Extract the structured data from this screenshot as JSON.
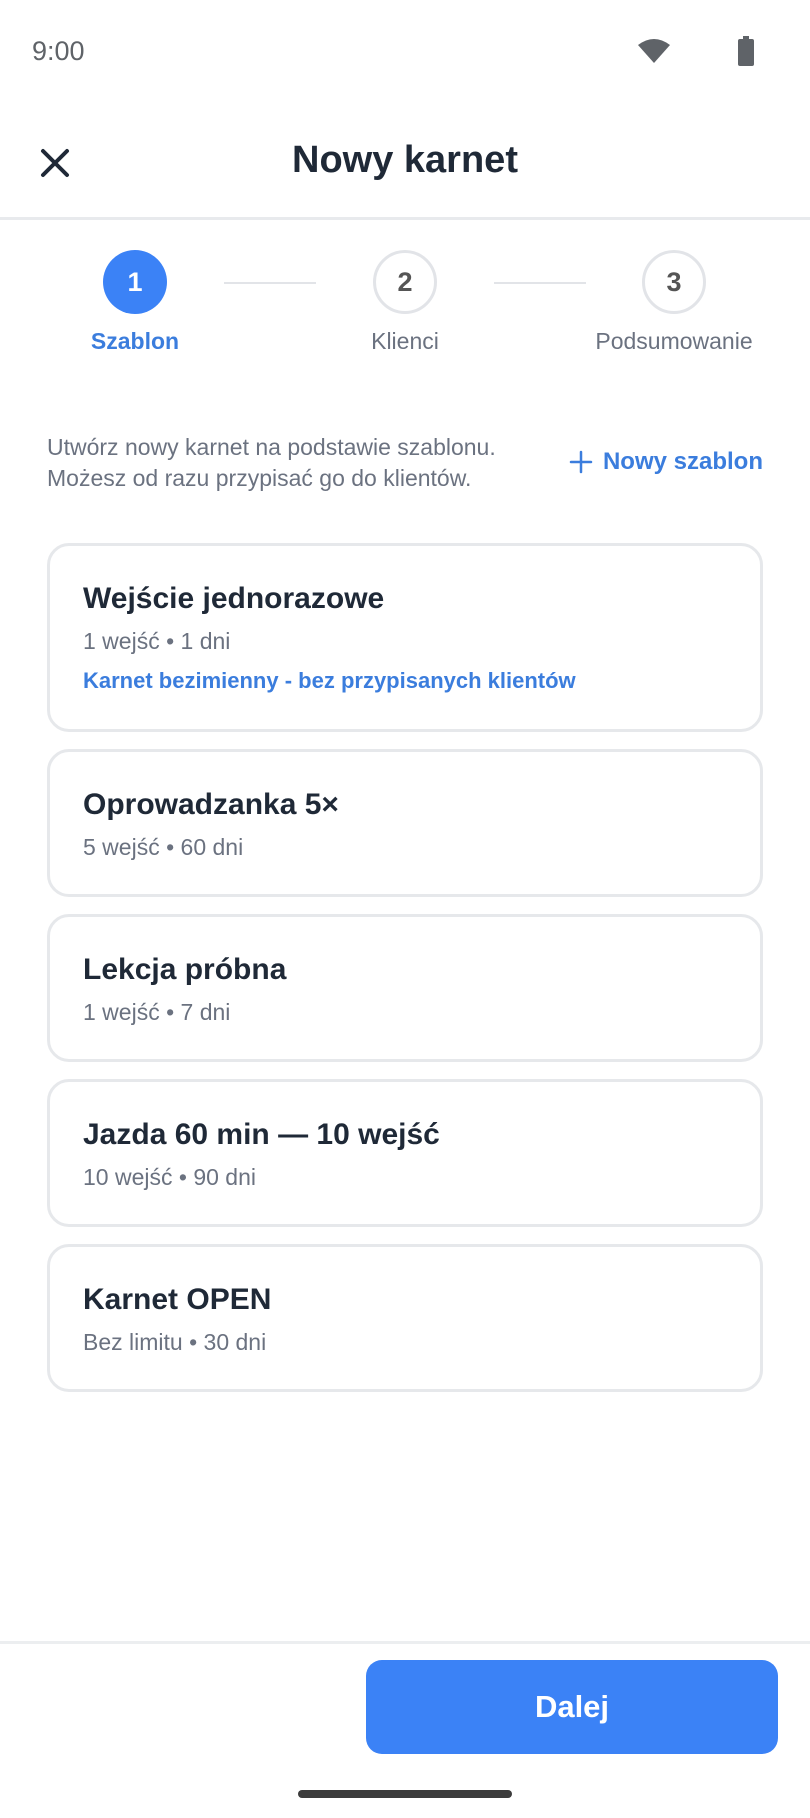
{
  "status_bar": {
    "time": "9:00",
    "wifi_icon": "wifi-icon",
    "battery_icon": "battery-icon"
  },
  "header": {
    "title": "Nowy karnet",
    "close_icon": "close-icon"
  },
  "stepper": {
    "steps": [
      {
        "number": "1",
        "label": "Szablon",
        "state": "active"
      },
      {
        "number": "2",
        "label": "Klienci",
        "state": "inactive"
      },
      {
        "number": "3",
        "label": "Podsumowanie",
        "state": "inactive"
      }
    ]
  },
  "intro": {
    "line1": "Utwórz nowy karnet na podstawie szablonu.",
    "line2": "Możesz od razu przypisać go do klientów.",
    "new_template_label": "Nowy szablon",
    "plus_icon": "plus-icon"
  },
  "templates": [
    {
      "name": "Wejście jednorazowe",
      "meta": "1 wejść • 1 dni",
      "note": "Karnet bezimienny - bez przypisanych klientów"
    },
    {
      "name": "Oprowadzanka 5×",
      "meta": "5 wejść • 60 dni"
    },
    {
      "name": "Lekcja próbna",
      "meta": "1 wejść • 7 dni"
    },
    {
      "name": "Jazda 60 min — 10 wejść",
      "meta": "10 wejść • 90 dni"
    },
    {
      "name": "Karnet OPEN",
      "meta": "Bez limitu • 30 dni"
    }
  ],
  "footer": {
    "next_label": "Dalej"
  },
  "colors": {
    "accent": "#3b82f6",
    "accent_text": "#3b7ddd",
    "text_primary": "#1f2937",
    "text_secondary": "#6b7280"
  }
}
